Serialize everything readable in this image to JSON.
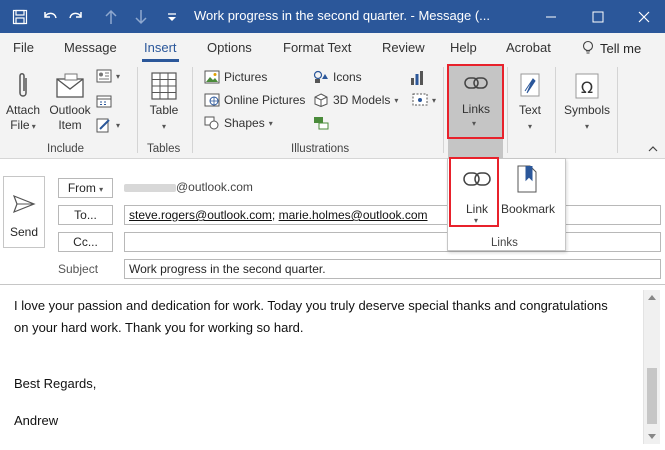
{
  "window": {
    "title": "Work progress in the second quarter.  -  Message (...",
    "minimize_icon": "minimize-icon",
    "restore_icon": "restore-icon",
    "close_icon": "close-icon"
  },
  "quick_access": [
    "save-icon",
    "undo-icon",
    "redo-icon",
    "up-arrow-icon",
    "down-arrow-icon",
    "customize-icon"
  ],
  "tabs": [
    {
      "label": "File"
    },
    {
      "label": "Message"
    },
    {
      "label": "Insert"
    },
    {
      "label": "Options"
    },
    {
      "label": "Format Text"
    },
    {
      "label": "Review"
    },
    {
      "label": "Help"
    },
    {
      "label": "Acrobat"
    }
  ],
  "active_tab": "Insert",
  "tell_me": "Tell me",
  "ribbon": {
    "include": {
      "label": "Include",
      "attach_file": [
        "Attach",
        "File"
      ],
      "outlook_item": [
        "Outlook",
        "Item"
      ]
    },
    "tables": {
      "label": "Tables",
      "table": "Table"
    },
    "illustrations": {
      "label": "Illustrations",
      "pictures": "Pictures",
      "online_pictures": "Online Pictures",
      "shapes": "Shapes",
      "icons": "Icons",
      "models_3d": "3D Models"
    },
    "links": {
      "label": "Links"
    },
    "text": {
      "label": "Text"
    },
    "symbols": {
      "label": "Symbols"
    }
  },
  "links_dropdown": {
    "link": "Link",
    "bookmark": "Bookmark",
    "group_label": "Links"
  },
  "compose": {
    "send": "Send",
    "from_button": "From",
    "from_value": "@outlook.com",
    "to_button": "To...",
    "to_recipients": [
      "steve.rogers@outlook.com",
      "marie.holmes@outlook.com"
    ],
    "to_separator": ";",
    "cc_button": "Cc...",
    "cc_value": "",
    "subject_label": "Subject",
    "subject_value": "Work progress in the second quarter."
  },
  "body": {
    "line1": "I love your passion and dedication for work. Today you truly deserve special thanks and congratulations",
    "line2": "on your hard work. Thank you for working so hard.",
    "closing": "Best Regards,",
    "signature": "Andrew"
  },
  "colors": {
    "titlebar": "#2b579a",
    "highlight": "#e8212b",
    "ribbon_bg": "#f3f3f3"
  }
}
